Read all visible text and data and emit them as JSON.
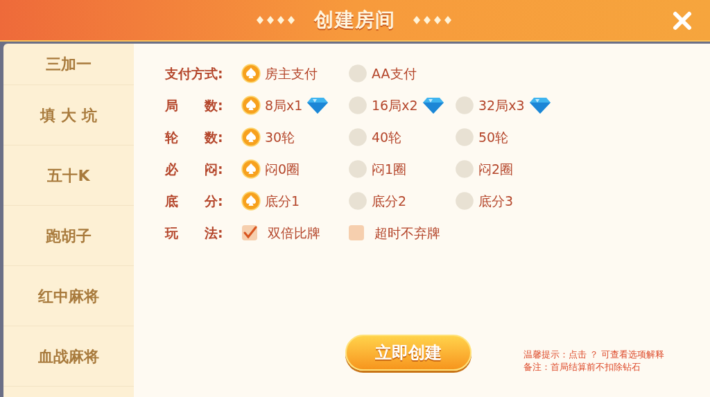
{
  "header": {
    "title": "创建房间"
  },
  "sidebar": {
    "items": [
      {
        "label": "三加一"
      },
      {
        "label": "填 大 坑"
      },
      {
        "label": "五十K"
      },
      {
        "label": "跑胡子"
      },
      {
        "label": "红中麻将"
      },
      {
        "label": "血战麻将"
      }
    ]
  },
  "settings": [
    {
      "label": "支付方式:",
      "kind": "radio",
      "options": [
        {
          "label": "房主支付",
          "selected": true
        },
        {
          "label": "AA支付",
          "selected": false
        }
      ]
    },
    {
      "label": "局　　数:",
      "kind": "radio",
      "options": [
        {
          "label": "8局x1",
          "selected": true,
          "diamond": true
        },
        {
          "label": "16局x2",
          "selected": false,
          "diamond": true
        },
        {
          "label": "32局x3",
          "selected": false,
          "diamond": true
        }
      ]
    },
    {
      "label": "轮　　数:",
      "kind": "radio",
      "options": [
        {
          "label": "30轮",
          "selected": true
        },
        {
          "label": "40轮",
          "selected": false
        },
        {
          "label": "50轮",
          "selected": false
        }
      ]
    },
    {
      "label": "必　　闷:",
      "kind": "radio",
      "options": [
        {
          "label": "闷0圈",
          "selected": true
        },
        {
          "label": "闷1圈",
          "selected": false
        },
        {
          "label": "闷2圈",
          "selected": false
        }
      ]
    },
    {
      "label": "底　　分:",
      "kind": "radio",
      "options": [
        {
          "label": "底分1",
          "selected": true
        },
        {
          "label": "底分2",
          "selected": false
        },
        {
          "label": "底分3",
          "selected": false
        }
      ]
    },
    {
      "label": "玩　　法:",
      "kind": "checkbox",
      "options": [
        {
          "label": "双倍比牌",
          "checked": true
        },
        {
          "label": "超时不弃牌",
          "checked": false
        }
      ]
    }
  ],
  "create_button": "立即创建",
  "notes": [
    "温馨提示：点击 ？ 可查看选项解释",
    "备注：首局结算前不扣除钻石"
  ]
}
